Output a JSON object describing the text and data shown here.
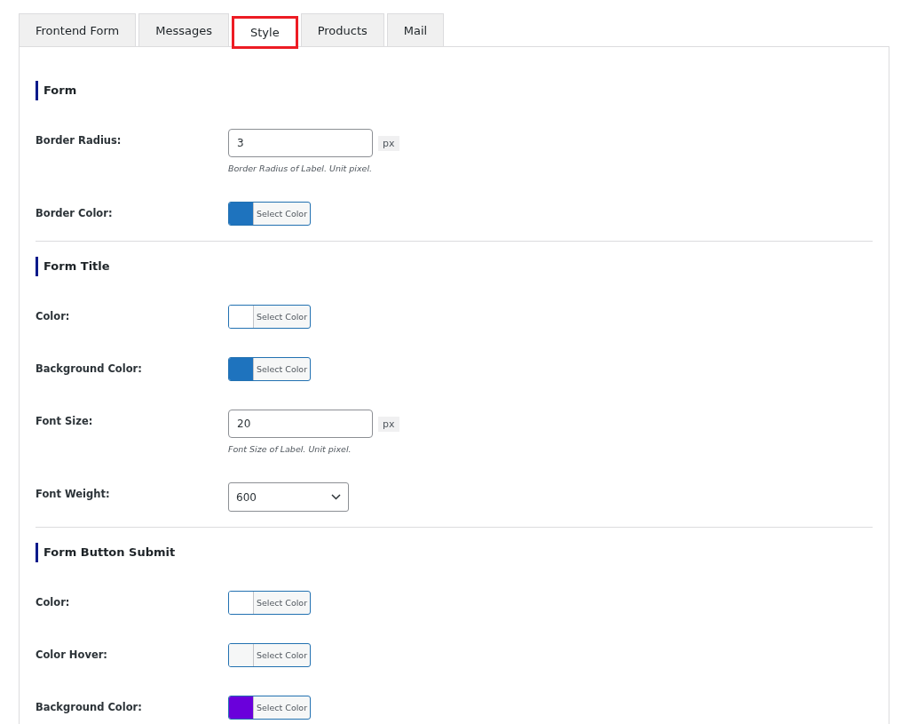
{
  "tabs": [
    {
      "label": "Frontend Form",
      "selected": false
    },
    {
      "label": "Messages",
      "selected": false
    },
    {
      "label": "Style",
      "selected": true
    },
    {
      "label": "Products",
      "selected": false
    },
    {
      "label": "Mail",
      "selected": false
    }
  ],
  "sections": [
    {
      "title": "Form",
      "fields": [
        {
          "kind": "number",
          "label": "Border Radius:",
          "value": "3",
          "unit": "px",
          "help": "Border Radius of Label. Unit pixel."
        },
        {
          "kind": "color",
          "label": "Border Color:",
          "color": "#1e73be",
          "button": "Select Color"
        }
      ]
    },
    {
      "title": "Form Title",
      "fields": [
        {
          "kind": "color",
          "label": "Color:",
          "color": "#ffffff",
          "button": "Select Color"
        },
        {
          "kind": "color",
          "label": "Background Color:",
          "color": "#1e73be",
          "button": "Select Color"
        },
        {
          "kind": "number",
          "label": "Font Size:",
          "value": "20",
          "unit": "px",
          "help": "Font Size of Label. Unit pixel."
        },
        {
          "kind": "select",
          "label": "Font Weight:",
          "value": "600"
        }
      ]
    },
    {
      "title": "Form Button Submit",
      "fields": [
        {
          "kind": "color",
          "label": "Color:",
          "color": "#ffffff",
          "button": "Select Color"
        },
        {
          "kind": "color",
          "label": "Color Hover:",
          "color": "#f6f7f7",
          "button": "Select Color"
        },
        {
          "kind": "color",
          "label": "Background Color:",
          "color": "#6a00db",
          "button": "Select Color"
        }
      ]
    }
  ]
}
